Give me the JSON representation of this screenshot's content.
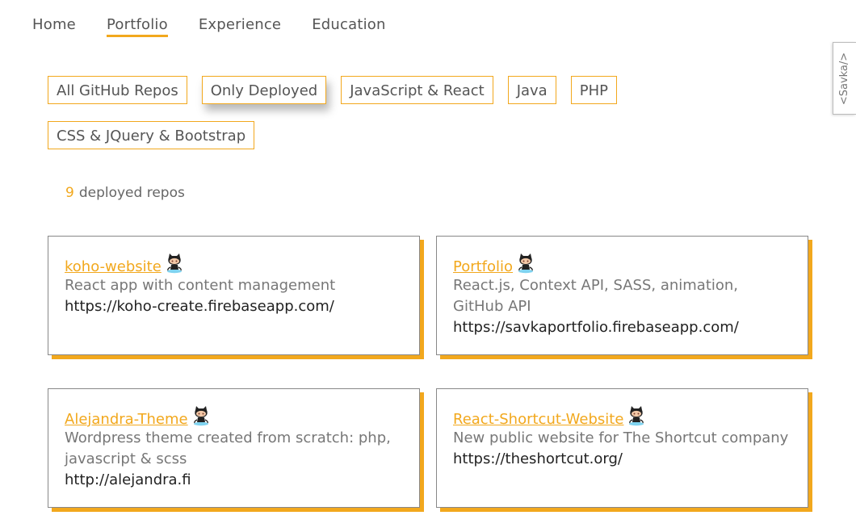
{
  "nav": {
    "items": [
      "Home",
      "Portfolio",
      "Experience",
      "Education"
    ],
    "active": "Portfolio"
  },
  "side_tab": "<Savka/>",
  "filters": {
    "row1": [
      "All GitHub Repos",
      "Only Deployed",
      "JavaScript & React",
      "Java",
      "PHP"
    ],
    "row2": [
      "CSS & JQuery & Bootstrap"
    ],
    "selected": "Only Deployed"
  },
  "count": {
    "number": "9",
    "label": "deployed repos"
  },
  "cards": [
    {
      "title": "koho-website",
      "description": "React app with content management",
      "url": "https://koho-create.firebaseapp.com/",
      "icon": "github-octocat-icon"
    },
    {
      "title": "Portfolio",
      "description": "React.js, Context API, SASS, animation, GitHub API",
      "url": "https://savkaportfolio.firebaseapp.com/",
      "icon": "github-octocat-icon"
    },
    {
      "title": "Alejandra-Theme",
      "description": "Wordpress theme created from scratch: php, javascript & scss",
      "url": "http://alejandra.fi",
      "icon": "github-octocat-icon"
    },
    {
      "title": "React-Shortcut-Website",
      "description": "New public website for The Shortcut company",
      "url": "https://theshortcut.org/",
      "icon": "github-octocat-icon"
    }
  ],
  "colors": {
    "accent": "#f2a81d",
    "text": "#555555",
    "url_text": "#222222"
  }
}
